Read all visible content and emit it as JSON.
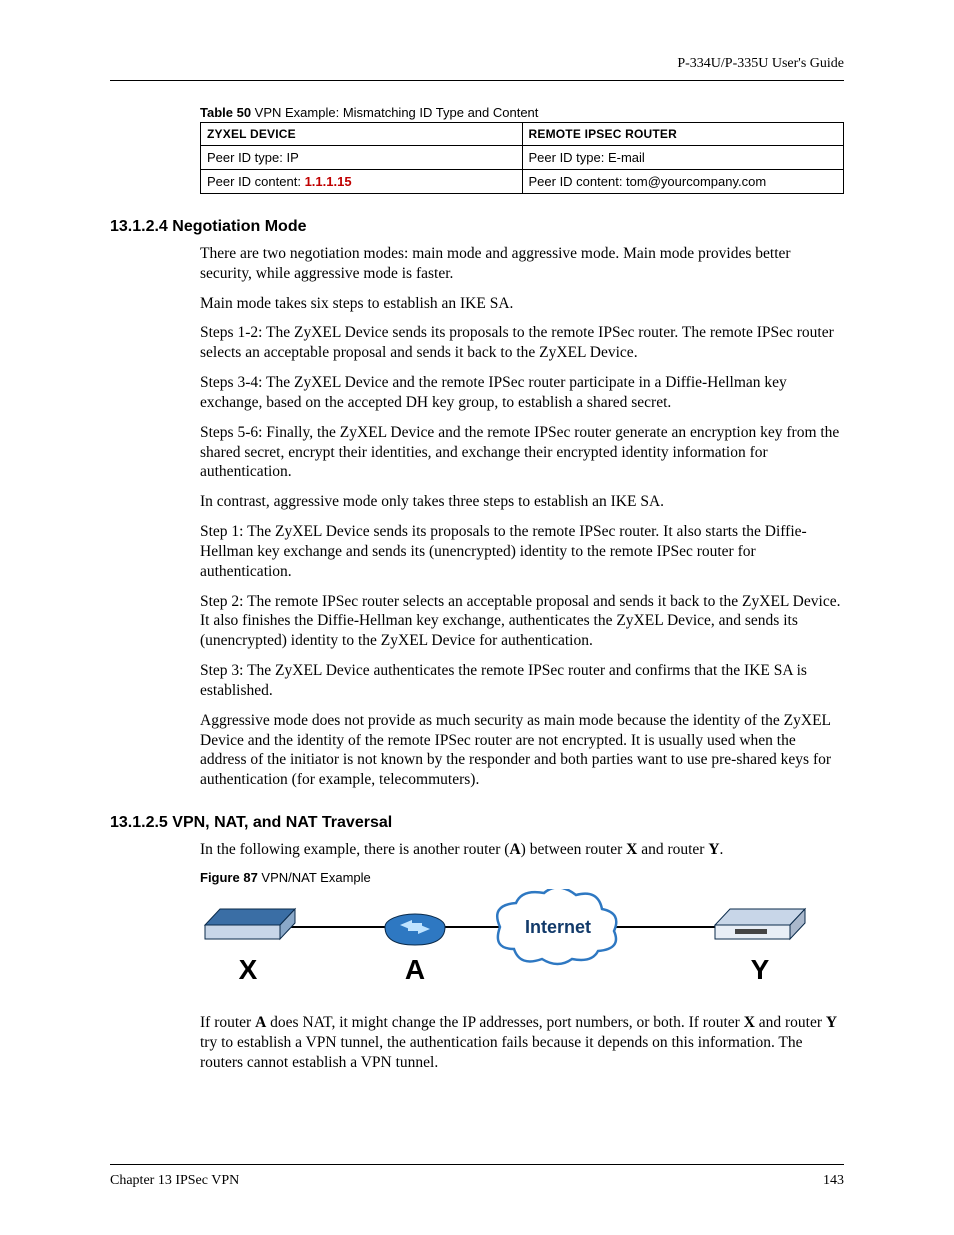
{
  "header": {
    "guide": "P-334U/P-335U User's Guide"
  },
  "table": {
    "caption_prefix": "Table 50",
    "caption_text": "   VPN Example: Mismatching ID Type and Content",
    "columns": [
      "ZYXEL DEVICE",
      "REMOTE IPSEC ROUTER"
    ],
    "rows": [
      {
        "left_plain": "Peer ID type: IP",
        "right_plain": "Peer ID type: E-mail"
      },
      {
        "left_pre": "Peer ID content: ",
        "left_red": "1.1.1.15",
        "right_plain": "Peer ID content: tom@yourcompany.com"
      }
    ]
  },
  "section1": {
    "num_title": "13.1.2.4  Negotiation Mode",
    "p1": "There are two negotiation modes: main mode and aggressive mode. Main mode provides better security, while aggressive mode is faster.",
    "p2": "Main mode takes six steps to establish an IKE SA.",
    "p3": "Steps 1-2: The ZyXEL Device sends its proposals to the remote IPSec router. The remote IPSec router selects an acceptable proposal and sends it back to the ZyXEL Device.",
    "p4": "Steps 3-4: The ZyXEL Device and the remote IPSec router participate in a Diffie-Hellman key exchange, based on the accepted DH key group, to establish a shared secret.",
    "p5": "Steps 5-6: Finally, the ZyXEL Device and the remote IPSec router generate an encryption key from the shared secret, encrypt their identities, and exchange their encrypted identity information for authentication.",
    "p6": "In contrast, aggressive mode only takes three steps to establish an IKE SA.",
    "p7": "Step 1: The ZyXEL Device sends its proposals to the remote IPSec router. It also starts the Diffie-Hellman key exchange and sends its (unencrypted) identity to the remote IPSec router for authentication.",
    "p8": "Step 2: The remote IPSec router selects an acceptable proposal and sends it back to the ZyXEL Device. It also finishes the Diffie-Hellman key exchange, authenticates the ZyXEL Device, and sends its (unencrypted) identity to the ZyXEL Device for authentication.",
    "p9": "Step 3: The ZyXEL Device authenticates the remote IPSec router and confirms that the IKE SA is established.",
    "p10": "Aggressive mode does not provide as much security as main mode because the identity of the ZyXEL Device and the identity of the remote IPSec router are not encrypted. It is usually used when the address of the initiator is not known by the responder and both parties want to use pre-shared keys for authentication (for example, telecommuters)."
  },
  "section2": {
    "num_title": "13.1.2.5  VPN, NAT, and NAT Traversal",
    "intro_pre": "In the following example, there is another router (",
    "intro_b1": "A",
    "intro_mid1": ") between router ",
    "intro_b2": "X",
    "intro_mid2": " and router ",
    "intro_b3": "Y",
    "intro_post": ".",
    "fig_prefix": "Figure 87",
    "fig_text": "   VPN/NAT Example",
    "labels": {
      "x": "X",
      "a": "A",
      "internet": "Internet",
      "y": "Y"
    },
    "after_pre": "If router ",
    "after_b1": "A",
    "after_mid1": " does NAT, it might change the IP addresses, port numbers, or both. If router ",
    "after_b2": "X",
    "after_mid2": " and router ",
    "after_b3": "Y",
    "after_post": " try to establish a VPN tunnel, the authentication fails because it depends on this information. The routers cannot establish a VPN tunnel."
  },
  "footer": {
    "left": "Chapter 13 IPSec VPN",
    "right": "143"
  }
}
